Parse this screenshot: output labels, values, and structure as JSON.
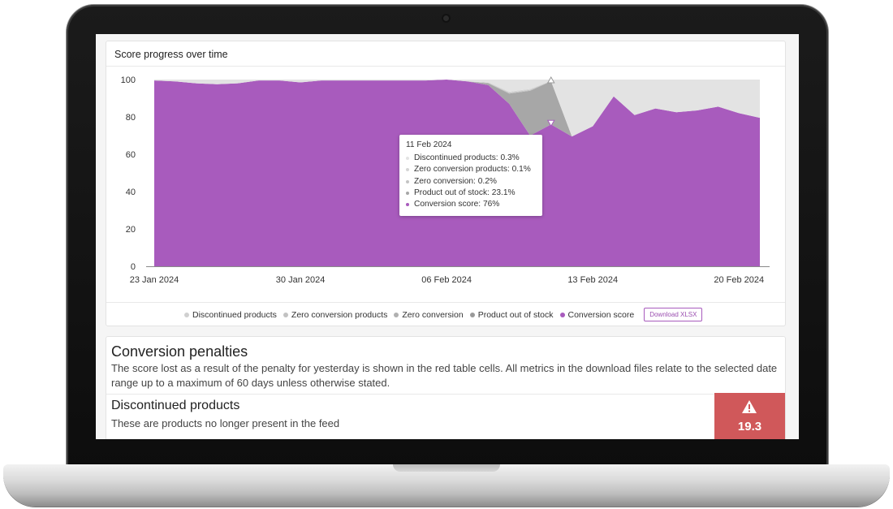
{
  "chart_card": {
    "title": "Score progress over time",
    "download_label": "Download XLSX"
  },
  "chart_data": {
    "type": "area",
    "stacked": true,
    "title": "Score progress over time",
    "x": [
      "23 Jan 2024",
      "24 Jan 2024",
      "25 Jan 2024",
      "26 Jan 2024",
      "27 Jan 2024",
      "28 Jan 2024",
      "29 Jan 2024",
      "30 Jan 2024",
      "31 Jan 2024",
      "01 Feb 2024",
      "02 Feb 2024",
      "03 Feb 2024",
      "04 Feb 2024",
      "05 Feb 2024",
      "06 Feb 2024",
      "07 Feb 2024",
      "08 Feb 2024",
      "09 Feb 2024",
      "10 Feb 2024",
      "11 Feb 2024",
      "12 Feb 2024",
      "13 Feb 2024",
      "14 Feb 2024",
      "15 Feb 2024",
      "16 Feb 2024",
      "17 Feb 2024",
      "18 Feb 2024",
      "19 Feb 2024",
      "20 Feb 2024",
      "21 Feb 2024"
    ],
    "x_tick_labels": [
      "23 Jan 2024",
      "30 Jan 2024",
      "06 Feb 2024",
      "13 Feb 2024",
      "20 Feb 2024"
    ],
    "x_tick_indices": [
      0,
      7,
      14,
      21,
      28
    ],
    "y_ticks": [
      0,
      20,
      40,
      60,
      80,
      100
    ],
    "ylim": [
      0,
      100
    ],
    "series": [
      {
        "name": "Conversion score",
        "color": "#a85bbd",
        "values": [
          99.5,
          99,
          98,
          97.5,
          98,
          99.5,
          99.5,
          98.5,
          99.5,
          99.5,
          99.5,
          99.5,
          99.5,
          99.5,
          100,
          99,
          97,
          87,
          70,
          76,
          69.5,
          75,
          91,
          81,
          84.5,
          82.5,
          83.5,
          85.5,
          82,
          79.5
        ]
      },
      {
        "name": "Product out of stock",
        "color": "#a7a7a7",
        "values": [
          0,
          0,
          0,
          0,
          0,
          0,
          0,
          0,
          0,
          0,
          0,
          0,
          0,
          0,
          0,
          0,
          1,
          5.5,
          24,
          23.1,
          0,
          0,
          0,
          0,
          0,
          0,
          0,
          0,
          0,
          0
        ]
      },
      {
        "name": "Zero conversion",
        "color": "#c4c4c4",
        "values": [
          0,
          0,
          0,
          0,
          0,
          0,
          0,
          0,
          0,
          0,
          0,
          0,
          0,
          0,
          0,
          0,
          0.3,
          0.5,
          0.5,
          0.2,
          0,
          0,
          0,
          0,
          0,
          0,
          0,
          0,
          0,
          0
        ]
      },
      {
        "name": "Zero conversion products",
        "color": "#d5d5d5",
        "values": [
          0,
          0,
          0,
          0,
          0,
          0,
          0,
          0,
          0,
          0,
          0,
          0,
          0,
          0,
          0,
          0,
          0.3,
          0.5,
          0.5,
          0.1,
          0,
          0,
          0,
          0,
          0,
          0,
          0,
          0,
          0,
          0
        ]
      },
      {
        "name": "Discontinued products",
        "color": "#e3e3e3",
        "values": [
          0.5,
          1,
          2,
          2.5,
          2,
          0.5,
          0.5,
          1.5,
          0.5,
          0.5,
          0.5,
          0.5,
          0.5,
          0.5,
          0,
          1,
          1.4,
          6.5,
          5,
          0.6,
          30.5,
          25,
          9,
          19,
          15.5,
          17.5,
          16.5,
          14.5,
          18,
          20.5
        ]
      }
    ],
    "tooltip": {
      "date": "11 Feb 2024",
      "rows": [
        {
          "label": "Discontinued products: ",
          "value": "0.3%",
          "color": "#e3e3e3"
        },
        {
          "label": "Zero conversion products: ",
          "value": "0.1%",
          "color": "#d5d5d5"
        },
        {
          "label": "Zero conversion: ",
          "value": "0.2%",
          "color": "#c4c4c4"
        },
        {
          "label": "Product out of stock: ",
          "value": "23.1%",
          "color": "#a7a7a7"
        },
        {
          "label": "Conversion score: ",
          "value": "76%",
          "color": "#a85bbd"
        }
      ]
    },
    "legend": [
      {
        "name": "Discontinued products",
        "color": "#d0d0d0"
      },
      {
        "name": "Zero conversion products",
        "color": "#c2c2c2"
      },
      {
        "name": "Zero conversion",
        "color": "#b0b0b0"
      },
      {
        "name": "Product out of stock",
        "color": "#9a9a9a"
      },
      {
        "name": "Conversion score",
        "color": "#a85bbd"
      }
    ],
    "legend_position": "bottom"
  },
  "penalties": {
    "title": "Conversion penalties",
    "description": "The score lost as a result of the penalty for yesterday is shown in the red table cells. All metrics in the download files relate to the selected date range up to a maximum of 60 days unless otherwise stated.",
    "discontinued": {
      "title": "Discontinued products",
      "description": "These are products no longer present in the feed",
      "penalty_value": "19.3",
      "penalty_color": "#d0585a",
      "icon": "warning-icon"
    }
  }
}
